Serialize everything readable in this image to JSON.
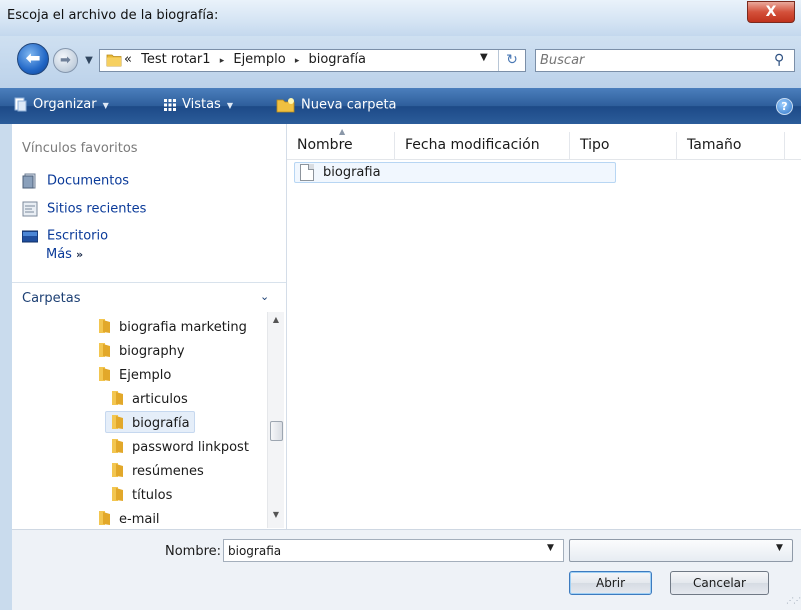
{
  "window": {
    "title": "Escoja el archivo de la biografía:",
    "close_label": "X"
  },
  "addressbar": {
    "prefix": "«",
    "crumbs": [
      "Test rotar1",
      "Ejemplo",
      "biografía"
    ],
    "crumb_separator": "▸"
  },
  "search": {
    "placeholder": "Buscar"
  },
  "toolbar": {
    "organize": "Organizar",
    "views": "Vistas",
    "new_folder": "Nueva carpeta",
    "help": "?"
  },
  "favorites": {
    "header": "Vínculos favoritos",
    "items": [
      {
        "label": "Documentos",
        "icon": "documents-icon"
      },
      {
        "label": "Sitios recientes",
        "icon": "recent-sites-icon"
      },
      {
        "label": "Escritorio",
        "icon": "desktop-icon"
      }
    ],
    "more": "Más",
    "more_glyph": "»"
  },
  "folders": {
    "header": "Carpetas",
    "toggle": "⌄",
    "items": [
      {
        "label": "biografia marketing",
        "level": 0
      },
      {
        "label": "biography",
        "level": 0
      },
      {
        "label": "Ejemplo",
        "level": 0
      },
      {
        "label": "articulos",
        "level": 1
      },
      {
        "label": "biografía",
        "level": 1,
        "selected": true
      },
      {
        "label": "password linkpost",
        "level": 1
      },
      {
        "label": "resúmenes",
        "level": 1
      },
      {
        "label": "títulos",
        "level": 1
      },
      {
        "label": "e-mail",
        "level": 0
      }
    ]
  },
  "filelist": {
    "columns": [
      "Nombre",
      "Fecha modificación",
      "Tipo",
      "Tamaño"
    ],
    "files": [
      {
        "name": "biografia",
        "icon": "text-file-icon"
      }
    ]
  },
  "bottom": {
    "name_label": "Nombre:",
    "name_value": "biografia",
    "filetype_value": "",
    "open_label": "Abrir",
    "cancel_label": "Cancelar"
  },
  "colors": {
    "accent": "#2b5c9a",
    "link": "#0a3a99",
    "folder": "#f0c040",
    "selection": "#e5eef9"
  }
}
